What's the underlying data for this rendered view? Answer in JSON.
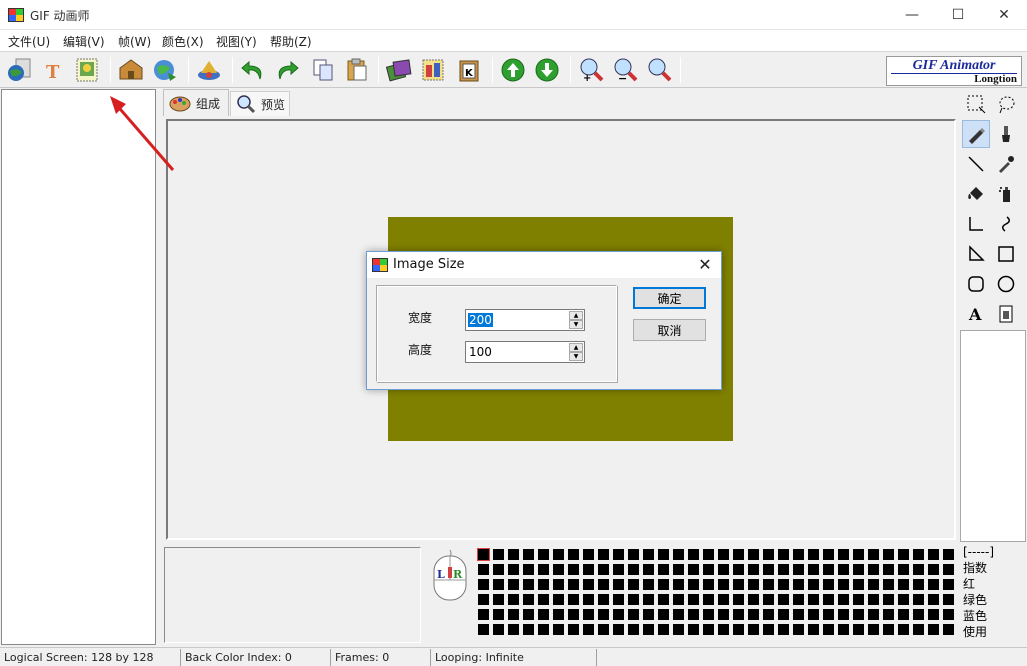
{
  "window": {
    "title": "GIF 动画师",
    "minimize": "—",
    "maximize": "☐",
    "close": "✕"
  },
  "menu": [
    "文件(U)",
    "编辑(V)",
    "帧(W)",
    "颜色(X)",
    "视图(Y)",
    "帮助(Z)"
  ],
  "brand": {
    "line1": "GIF Animator",
    "line2": "Longtion"
  },
  "tabs": {
    "compose": "组成",
    "preview": "预览"
  },
  "dialog": {
    "title": "Image Size",
    "close": "✕",
    "width_label": "宽度",
    "width_value": "200",
    "height_label": "高度",
    "height_value": "100",
    "ok": "确定",
    "cancel": "取消"
  },
  "color_info": [
    "[-----]",
    "指数",
    "红",
    "绿色",
    "蓝色",
    "使用"
  ],
  "status": {
    "logical_screen": "Logical Screen: 128 by 128",
    "back_color": "Back Color Index: 0",
    "frames": "Frames: 0",
    "looping": "Looping: Infinite"
  },
  "mouse": {
    "left": "L",
    "right": "R"
  },
  "colors": {
    "image_fill": "#808000",
    "annotation_arrow": "#d62020",
    "accent": "#0078d7"
  }
}
